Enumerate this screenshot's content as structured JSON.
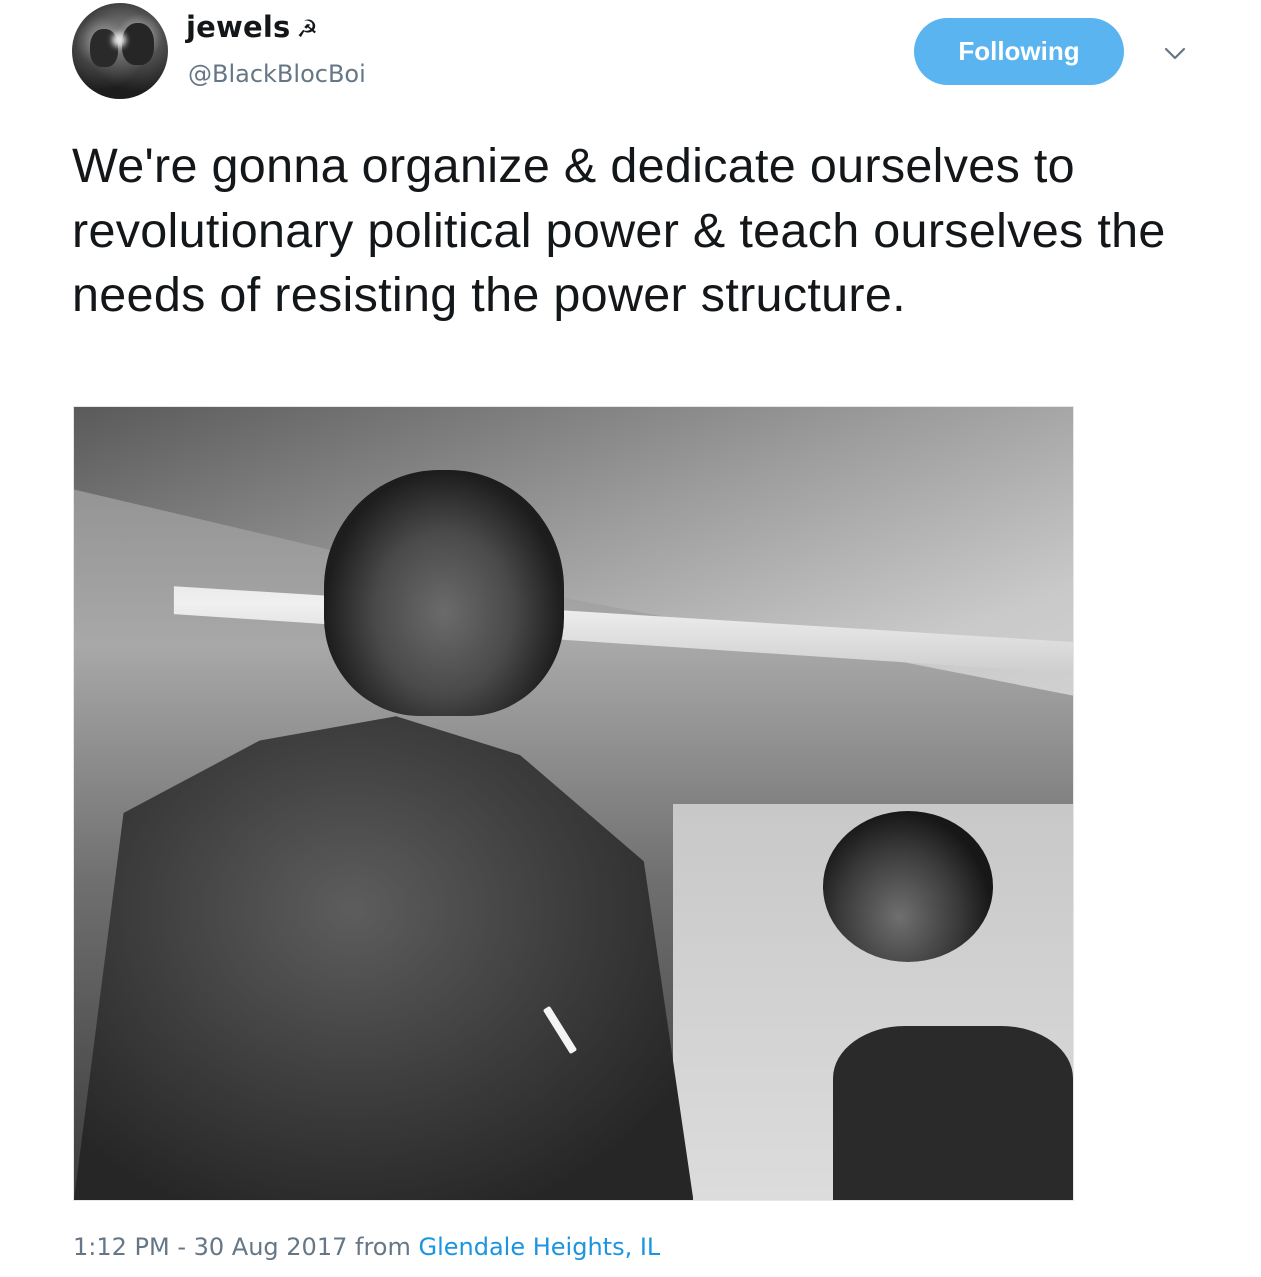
{
  "tweet": {
    "author": {
      "display_name": "jewels",
      "name_emoji": "☭",
      "handle": "@BlackBlocBoi"
    },
    "follow_button_label": "Following",
    "text": "We're gonna organize & dedicate ourselves to revolutionary political power & teach ourselves the needs of resisting the power structure.",
    "timestamp": "1:12 PM - 30 Aug 2017",
    "from_label": "from",
    "location": "Glendale Heights, IL"
  },
  "colors": {
    "follow_button_bg": "#59b4ef",
    "secondary_text": "#657786",
    "link": "#1b95e0",
    "primary_text": "#14171a"
  },
  "icons": {
    "caret": "chevron-down-icon"
  }
}
